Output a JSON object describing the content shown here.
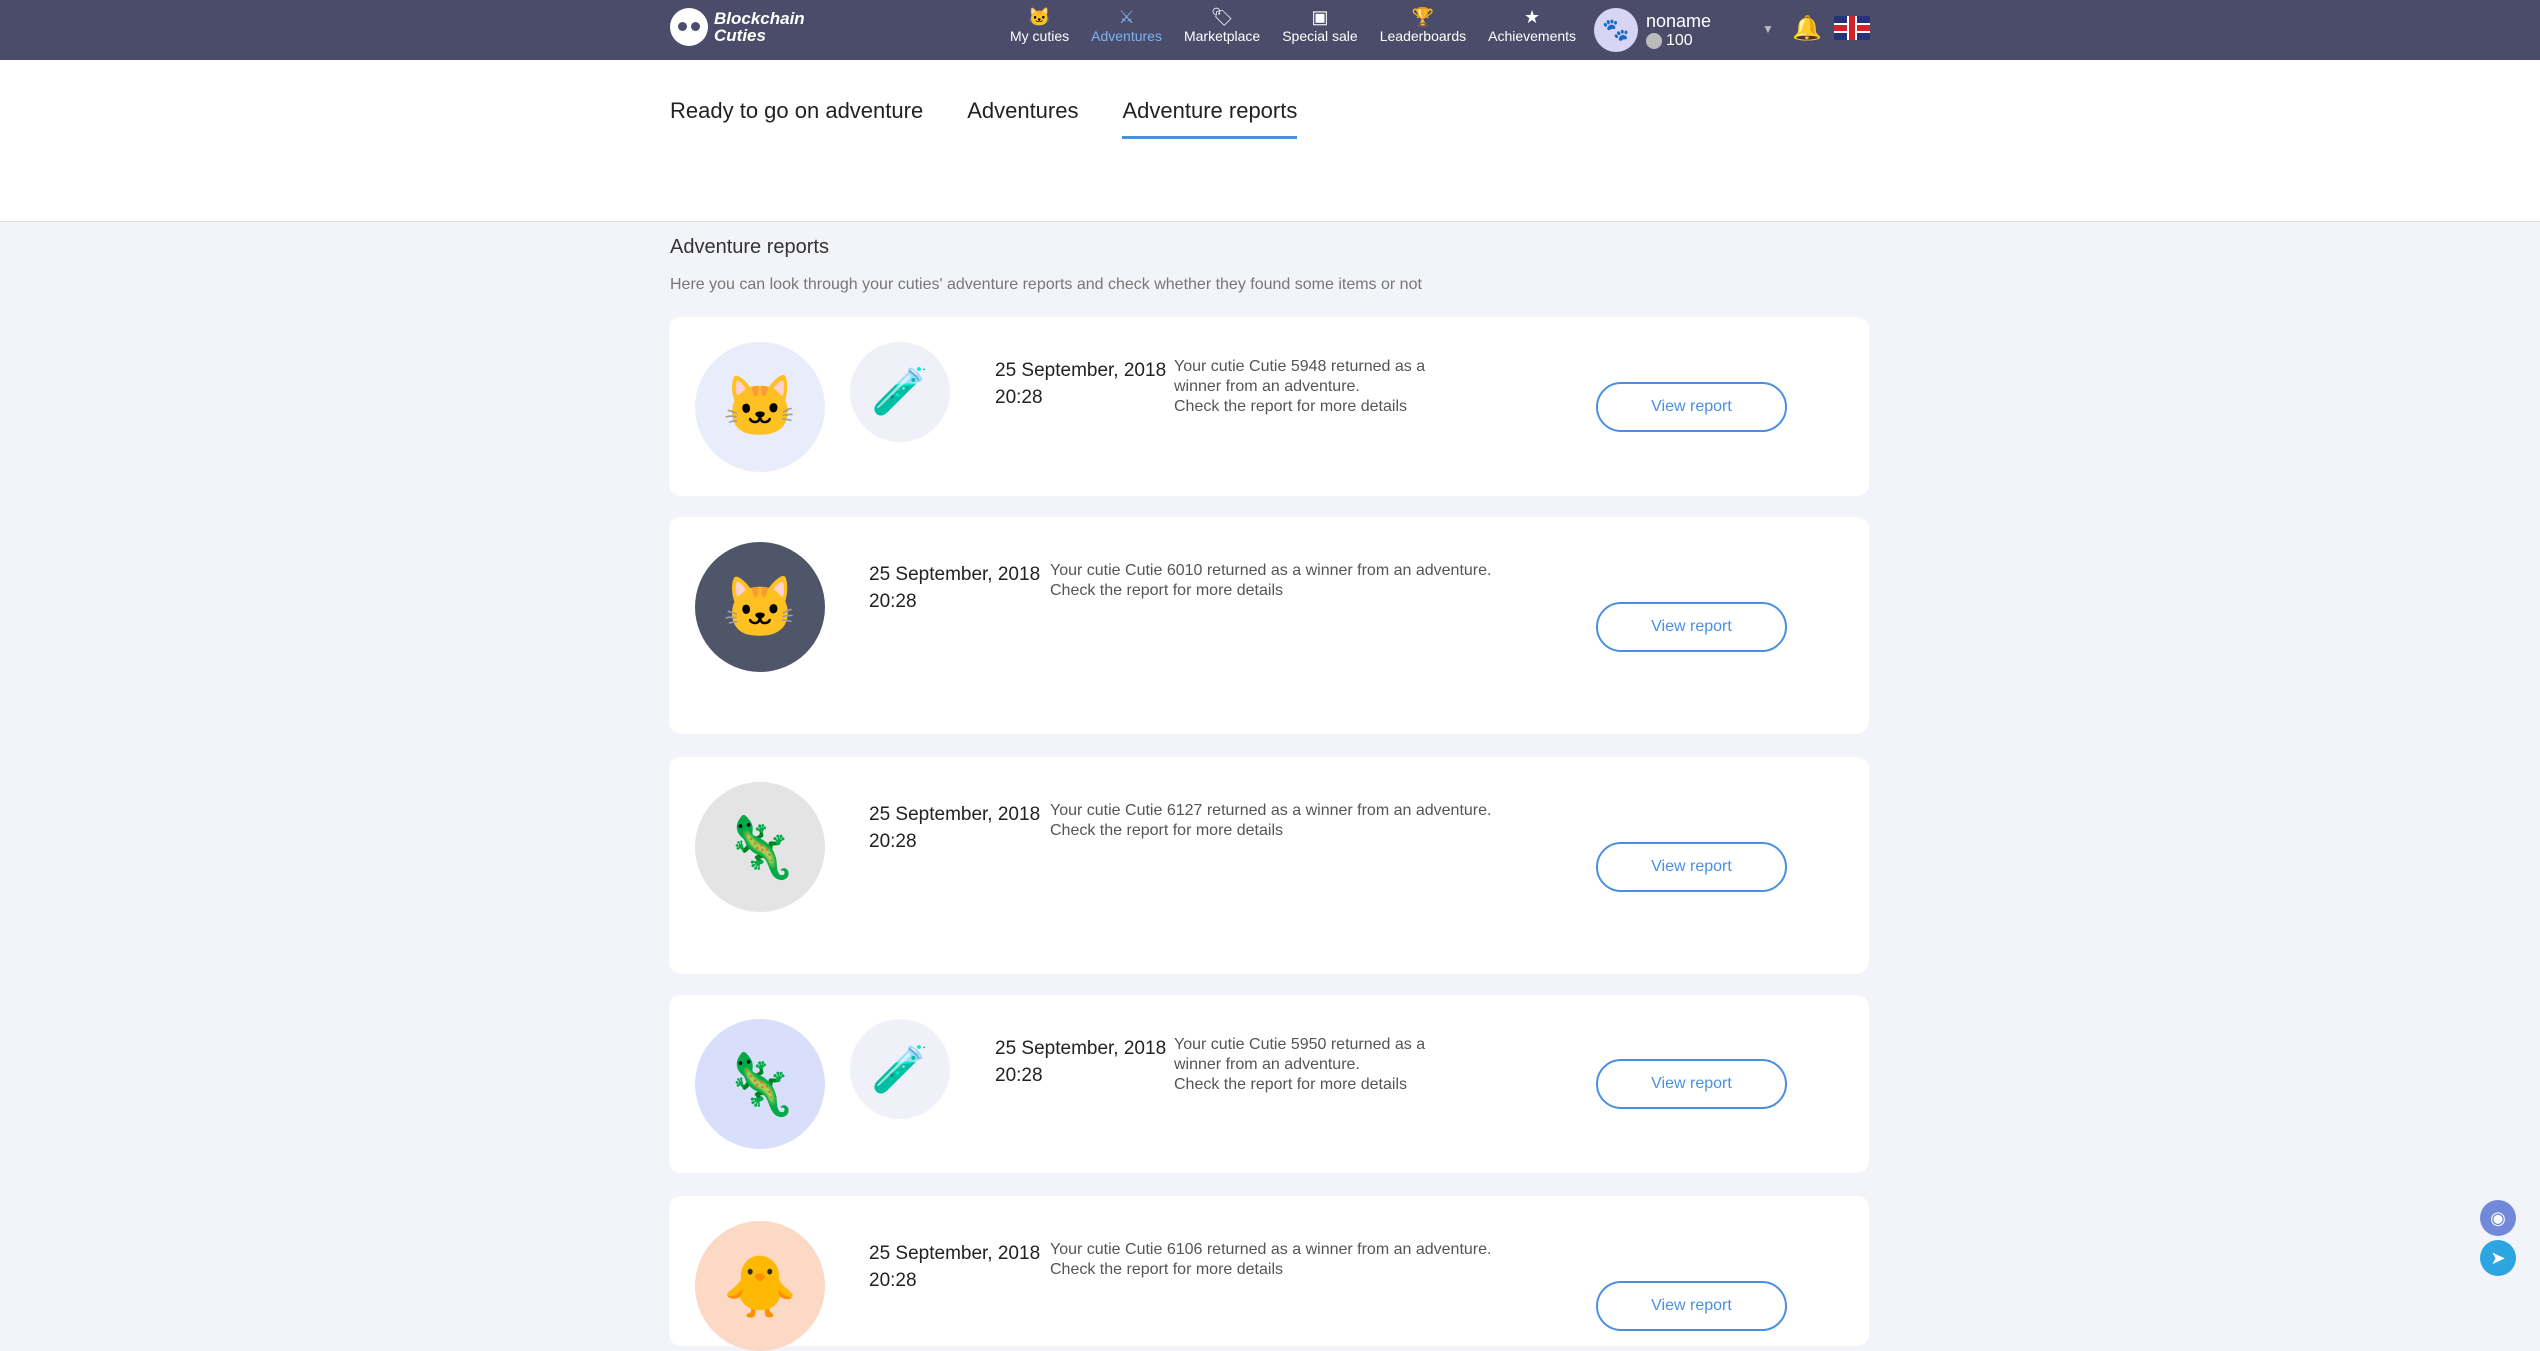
{
  "header": {
    "logo_line1": "Blockchain",
    "logo_line2": "Cuties",
    "nav": [
      {
        "label": "My cuties",
        "icon": "🐱"
      },
      {
        "label": "Adventures",
        "icon": "⚔"
      },
      {
        "label": "Marketplace",
        "icon": "🏷"
      },
      {
        "label": "Special sale",
        "icon": "▣"
      },
      {
        "label": "Leaderboards",
        "icon": "🏆"
      },
      {
        "label": "Achievements",
        "icon": "★"
      }
    ],
    "user": {
      "name": "noname",
      "balance": "100"
    }
  },
  "tabs": [
    "Ready to go on adventure",
    "Adventures",
    "Adventure reports"
  ],
  "section": {
    "title": "Adventure reports",
    "subtitle": "Here you can look through your cuties' adventure reports and check whether they found some items or not"
  },
  "reports": [
    {
      "date": "25 September, 2018",
      "time": "20:28",
      "msg1": "Your cutie Cutie 5948 returned as a",
      "msg2": "winner from an adventure.",
      "msg3": "Check the report for more details",
      "button": "View report",
      "cutie": "🐱",
      "item": "🧪",
      "bg": "#e9ecfb"
    },
    {
      "date": "25 September, 2018",
      "time": "20:28",
      "msg1": "Your cutie Cutie 6010 returned as a winner from an adventure.",
      "msg2": "Check the report for more details",
      "button": "View report",
      "cutie": "🐱",
      "bg": "#4f5669"
    },
    {
      "date": "25 September, 2018",
      "time": "20:28",
      "msg1": "Your cutie Cutie 6127 returned as a winner from an adventure.",
      "msg2": "Check the report for more details",
      "button": "View report",
      "cutie": "🦎",
      "bg": "#e4e4e4"
    },
    {
      "date": "25 September, 2018",
      "time": "20:28",
      "msg1": "Your cutie Cutie 5950 returned as a",
      "msg2": "winner from an adventure.",
      "msg3": "Check the report for more details",
      "button": "View report",
      "cutie": "🦎",
      "item": "🧪",
      "bg": "#d9defa"
    },
    {
      "date": "25 September, 2018",
      "time": "20:28",
      "msg1": "Your cutie Cutie 6106 returned as a winner from an adventure.",
      "msg2": "Check the report for more details",
      "button": "View report",
      "cutie": "🐥",
      "bg": "#fbd9c4"
    }
  ]
}
